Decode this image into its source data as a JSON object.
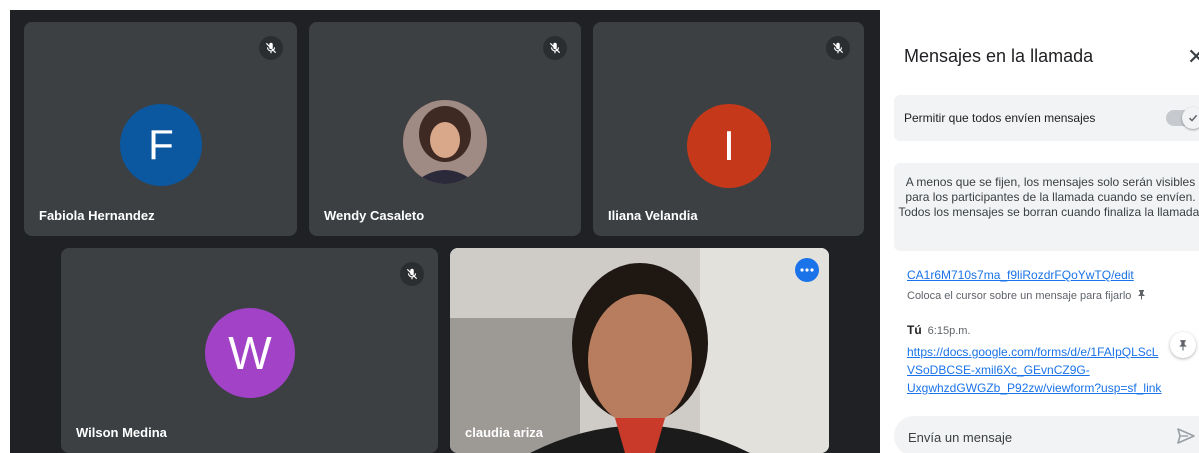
{
  "participants": [
    {
      "name": "Fabiola Hernandez",
      "initial": "F",
      "avatar_color": "#0b57a0",
      "muted": true
    },
    {
      "name": "Wendy Casaleto",
      "initial": "",
      "avatar_color": "#8d6e63",
      "muted": true
    },
    {
      "name": "Iliana Velandia",
      "initial": "I",
      "avatar_color": "#c5391a",
      "muted": true
    },
    {
      "name": "Wilson Medina",
      "initial": "W",
      "avatar_color": "#a142c7",
      "muted": true
    },
    {
      "name": "claudia ariza",
      "initial": "",
      "avatar_color": "",
      "muted": false,
      "active_speaker": true
    }
  ],
  "chat_panel": {
    "title": "Mensajes en la llamada",
    "close_icon": "close-icon",
    "allow_all_label": "Permitir que todos envíen mensajes",
    "allow_all_enabled": true,
    "info_text": "A menos que se fijen, los mensajes solo serán visibles para los participantes de la llamada cuando se envíen. Todos los mensajes se borran cuando finaliza la llamada.",
    "pinned_link": "CA1r6M710s7ma_f9liRozdrFQoYwTQ/edit",
    "pin_hint": "Coloca el cursor sobre un mensaje para fijarlo",
    "messages": [
      {
        "sender": "Tú",
        "time": "6:15p.m.",
        "text": "https://docs.google.com/forms/d/e/1FAIpQLScL\nVSoDBCSE-xmil6Xc_GEvnCZ9G-\nUxgwhzdGWGZb_P92zw/viewform?usp=sf_link"
      }
    ],
    "compose_placeholder": "Envía un mensaje"
  },
  "colors": {
    "stage_bg": "#202124",
    "tile_bg": "#3c4043",
    "accent": "#1a73e8",
    "link": "#1a73e8"
  }
}
